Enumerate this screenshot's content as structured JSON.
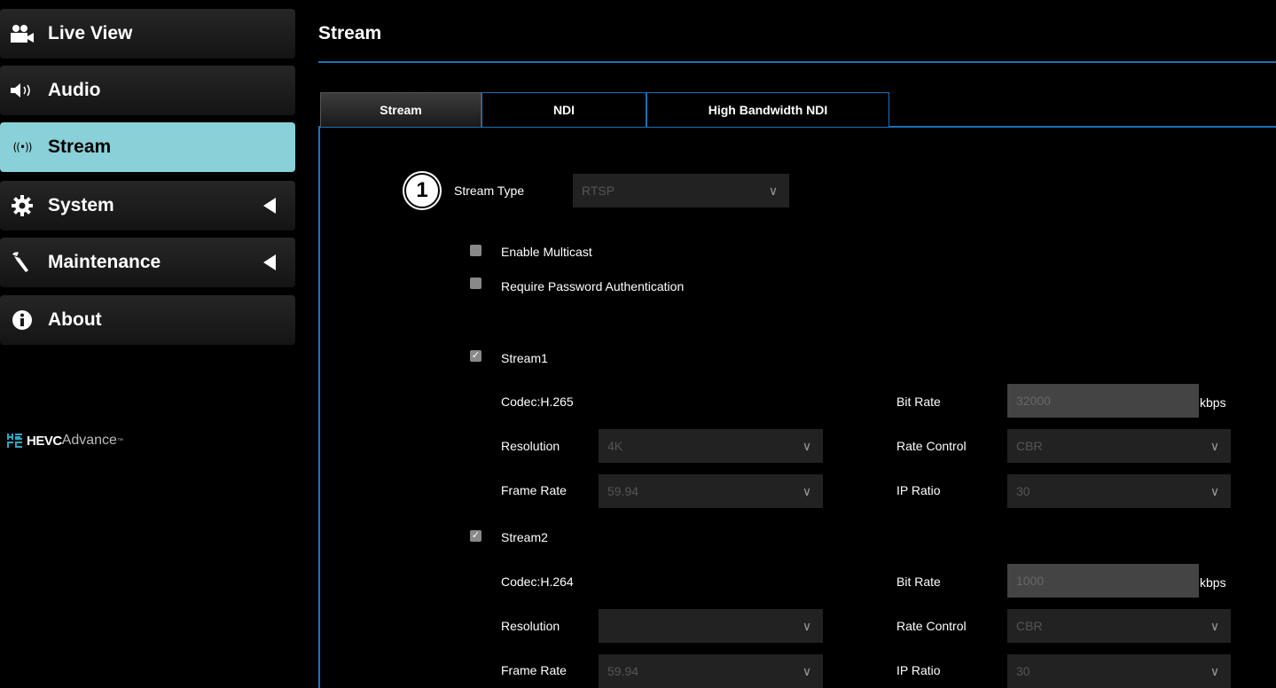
{
  "sidebar": {
    "items": [
      {
        "label": "Live View",
        "icon": "video-camera-icon"
      },
      {
        "label": "Audio",
        "icon": "speaker-icon"
      },
      {
        "label": "Stream",
        "icon": "broadcast-icon",
        "active": true,
        "glyph": "((•))"
      },
      {
        "label": "System",
        "icon": "gear-icon"
      },
      {
        "label": "Maintenance",
        "icon": "wrench-icon"
      },
      {
        "label": "About",
        "icon": "info-icon"
      }
    ],
    "logo": {
      "prefix": "HEVC",
      "suffix": "Advance",
      "tm": "™"
    }
  },
  "header": {
    "title": "Stream"
  },
  "tabs": [
    {
      "label": "Stream",
      "active": true
    },
    {
      "label": "NDI"
    },
    {
      "label": "High Bandwidth NDI"
    }
  ],
  "badge": "1",
  "form": {
    "stream_type_label": "Stream Type",
    "stream_type_value": "RTSP",
    "enable_multicast": "Enable Multicast",
    "require_password": "Require Password Authentication",
    "labels": {
      "resolution": "Resolution",
      "frame_rate": "Frame Rate",
      "bit_rate": "Bit Rate",
      "rate_control": "Rate Control",
      "ip_ratio": "IP Ratio",
      "kbps": "kbps"
    },
    "stream1": {
      "label": "Stream1",
      "codec": "Codec:H.265",
      "resolution": "4K",
      "frame_rate": "59.94",
      "bit_rate": "32000",
      "rate_control": "CBR",
      "ip_ratio": "30"
    },
    "stream2": {
      "label": "Stream2",
      "codec": "Codec:H.264",
      "resolution": "",
      "frame_rate": "59.94",
      "bit_rate": "1000",
      "rate_control": "CBR",
      "ip_ratio": "30"
    }
  },
  "colors": {
    "accent": "#1a72b8",
    "active_nav": "#8ad0d8"
  }
}
